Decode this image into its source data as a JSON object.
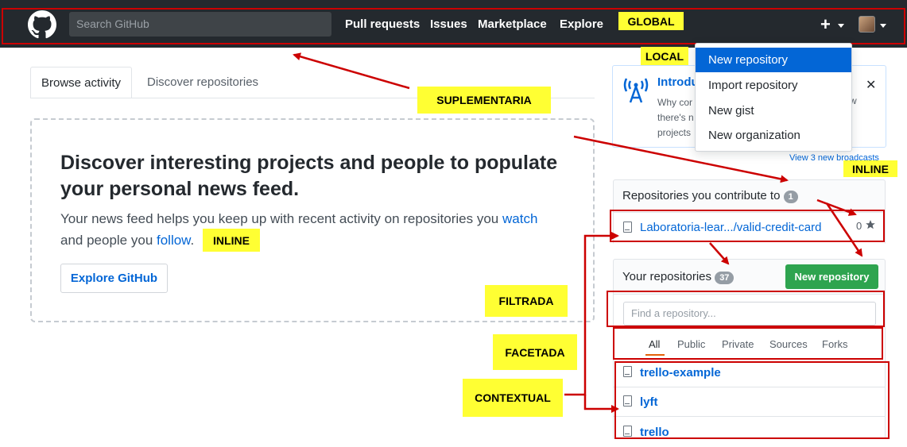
{
  "header": {
    "search_placeholder": "Search GitHub",
    "nav": [
      "Pull requests",
      "Issues",
      "Marketplace",
      "Explore"
    ],
    "plus": "+"
  },
  "dropdown": {
    "items": [
      "New repository",
      "Import repository",
      "New gist",
      "New organization"
    ]
  },
  "tabs": [
    "Browse activity",
    "Discover repositories"
  ],
  "discover": {
    "title": "Discover interesting projects and people to populate your personal news feed.",
    "text_before_watch": "Your news feed helps you keep up with recent activity on repositories you ",
    "watch": "watch",
    "text_mid": "and people you ",
    "follow": "follow",
    "text_after": ".",
    "button": "Explore GitHub"
  },
  "broadcast": {
    "title": "Introdu",
    "line1": "Why cor",
    "line1_tail": "w",
    "line2": "there's n",
    "line3": "projects",
    "close": "✕",
    "footer": "View 3 new broadcasts"
  },
  "contribute": {
    "title": "Repositories you contribute to",
    "count": "1",
    "repo": "Laboratoria-lear.../valid-credit-card",
    "stars": "0"
  },
  "your_repos": {
    "title": "Your repositories",
    "count": "37",
    "new_button": "New repository",
    "find_placeholder": "Find a repository...",
    "filters": [
      "All",
      "Public",
      "Private",
      "Sources",
      "Forks"
    ],
    "repos": [
      "trello-example",
      "lyft",
      "trello"
    ]
  },
  "annotations": {
    "global": "GLOBAL",
    "local": "LOCAL",
    "suplementaria": "SUPLEMENTARIA",
    "inline_top": "INLINE",
    "inline_feed": "INLINE",
    "filtrada": "FILTRADA",
    "facetada": "FACETADA",
    "contextual": "CONTEXTUAL"
  },
  "colors": {
    "header_bg": "#24292e",
    "accent": "#0366d6",
    "annotation_bg": "#ffff33",
    "annotation_border": "#cc0000",
    "green_button": "#2ea44f"
  }
}
